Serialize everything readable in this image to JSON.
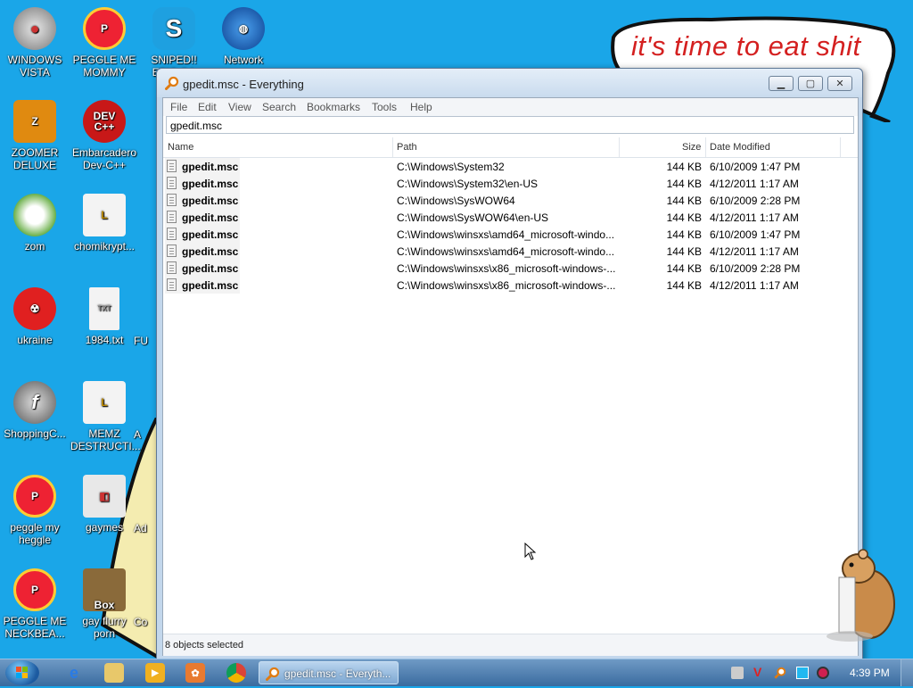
{
  "wallpaper": {
    "speech_text": "it's time to eat shit"
  },
  "desktop_icons": [
    {
      "label": "WINDOWS VISTA"
    },
    {
      "label": "PEGGLE ME MOMMY"
    },
    {
      "label": "SNIPED!! EPIC GA"
    },
    {
      "label": "Network"
    },
    {
      "label": "ZOOMER DELUXE"
    },
    {
      "label": "Embarcadero Dev-C++"
    },
    {
      "label": "zom"
    },
    {
      "label": "chomikrypt..."
    },
    {
      "label": "ukraine"
    },
    {
      "label": "1984.txt"
    },
    {
      "label": "FU"
    },
    {
      "label": "ShoppingC..."
    },
    {
      "label": "MEMZ DESTRUCTI..."
    },
    {
      "label": "A"
    },
    {
      "label": "peggle my heggle"
    },
    {
      "label": "gaymes"
    },
    {
      "label": "Ad"
    },
    {
      "label": "PEGGLE ME NECKBEA..."
    },
    {
      "label": "gay flurry porn"
    },
    {
      "label": "Co"
    },
    {
      "label": "Box"
    }
  ],
  "window": {
    "title": "gpedit.msc - Everything",
    "menu": [
      "File",
      "Edit",
      "View",
      "Search",
      "Bookmarks",
      "Tools",
      "Help"
    ],
    "search_value": "gpedit.msc",
    "columns": {
      "name": "Name",
      "path": "Path",
      "size": "Size",
      "date": "Date Modified"
    },
    "rows": [
      {
        "name": "gpedit.msc",
        "path": "C:\\Windows\\System32",
        "size": "144 KB",
        "date": "6/10/2009 1:47 PM"
      },
      {
        "name": "gpedit.msc",
        "path": "C:\\Windows\\System32\\en-US",
        "size": "144 KB",
        "date": "4/12/2011 1:17 AM"
      },
      {
        "name": "gpedit.msc",
        "path": "C:\\Windows\\SysWOW64",
        "size": "144 KB",
        "date": "6/10/2009 2:28 PM"
      },
      {
        "name": "gpedit.msc",
        "path": "C:\\Windows\\SysWOW64\\en-US",
        "size": "144 KB",
        "date": "4/12/2011 1:17 AM"
      },
      {
        "name": "gpedit.msc",
        "path": "C:\\Windows\\winsxs\\amd64_microsoft-windo...",
        "size": "144 KB",
        "date": "6/10/2009 1:47 PM"
      },
      {
        "name": "gpedit.msc",
        "path": "C:\\Windows\\winsxs\\amd64_microsoft-windo...",
        "size": "144 KB",
        "date": "4/12/2011 1:17 AM"
      },
      {
        "name": "gpedit.msc",
        "path": "C:\\Windows\\winsxs\\x86_microsoft-windows-...",
        "size": "144 KB",
        "date": "6/10/2009 2:28 PM"
      },
      {
        "name": "gpedit.msc",
        "path": "C:\\Windows\\winsxs\\x86_microsoft-windows-...",
        "size": "144 KB",
        "date": "4/12/2011 1:17 AM"
      }
    ],
    "status": "8 objects selected"
  },
  "taskbar": {
    "task_label": "gpedit.msc - Everyth...",
    "clock": "4:39 PM"
  },
  "colors": {
    "desktop_bg": "#1aa6e8",
    "speech_text": "#d42020",
    "wallpaper_yellow": "#f4ecb0"
  }
}
